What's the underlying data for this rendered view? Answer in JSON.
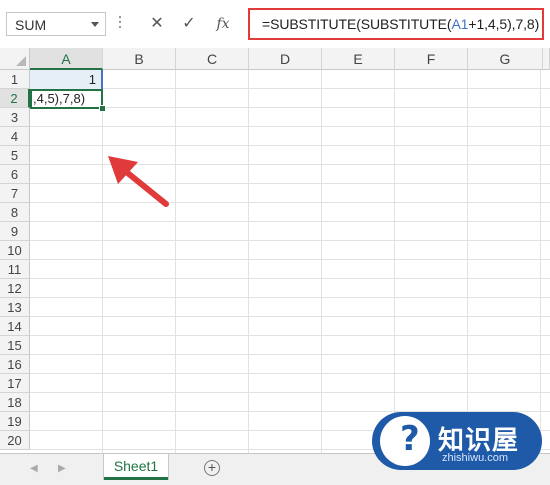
{
  "formula_bar": {
    "name_box": "SUM",
    "cancel_icon": "✕",
    "enter_icon": "✓",
    "fx_label": "fx",
    "formula_prefix": "=SUBSTITUTE(SUBSTITUTE(",
    "formula_ref": "A1",
    "formula_suffix": "+1,4,5),7,8)"
  },
  "columns": [
    "A",
    "B",
    "C",
    "D",
    "E",
    "F",
    "G"
  ],
  "rows": [
    "1",
    "2",
    "3",
    "4",
    "5",
    "6",
    "7",
    "8",
    "9",
    "10",
    "11",
    "12",
    "13",
    "14",
    "15",
    "16",
    "17",
    "18",
    "19",
    "20"
  ],
  "cells": {
    "A1": "1",
    "A2": ",4,5),7,8)"
  },
  "sheets": {
    "active": "Sheet1",
    "add_icon": "+"
  },
  "watermark": {
    "title": "知识屋",
    "subtitle": "zhishiwu.com",
    "icon": "?"
  },
  "colors": {
    "accent_green": "#217346",
    "highlight_red": "#e03a3a",
    "ref_blue": "#4472c4"
  }
}
